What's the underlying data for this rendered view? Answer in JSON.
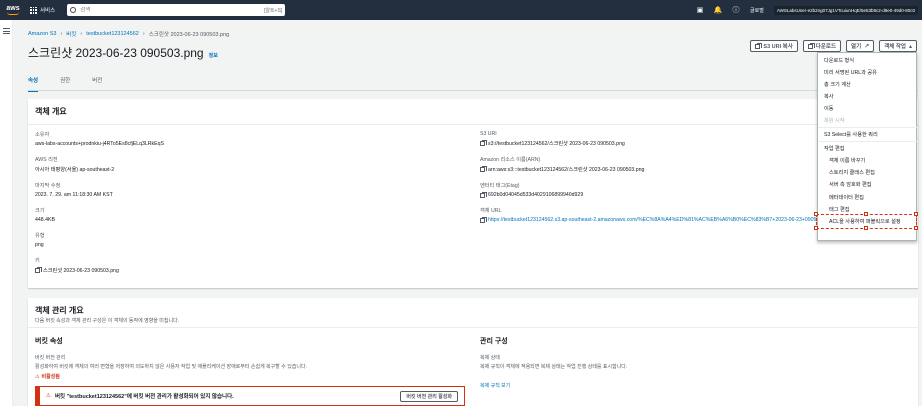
{
  "topnav": {
    "logo": "aws",
    "services": "서비스",
    "search_placeholder": "검색",
    "search_hint": "[알트+S]",
    "region": "글로벌",
    "account": "AWSLabsUser-e2b2ng07Jg1VTcuiunHqE/5e53b9c2-d9e0-49d0-80c0"
  },
  "breadcrumb": [
    "Amazon S3",
    "버킷",
    "testbucket123124562",
    "스크린샷 2023-06-23 090503.png"
  ],
  "title": "스크린샷 2023-06-23 090503.png",
  "info_link": "정보",
  "actions": {
    "copy_uri": "S3 URI 복사",
    "download": "다운로드",
    "open": "열기",
    "object_actions": "객체 작업"
  },
  "tabs": [
    "속성",
    "권한",
    "버전"
  ],
  "overview": {
    "heading": "객체 개요",
    "left": [
      {
        "label": "소유자",
        "value": "aws-labs-accounts+prodnkiu-j4RTo5Es8cfjELq3LRkEqS"
      },
      {
        "label": "AWS 리전",
        "value": "아시아 태평양(서울) ap-southeast-2"
      },
      {
        "label": "마지막 수정",
        "value": "2023. 7. 29. am 11:18:30 AM KST"
      },
      {
        "label": "크기",
        "value": "448.4KB"
      },
      {
        "label": "유형",
        "value": "png"
      },
      {
        "label": "키",
        "value": "스크린샷 2023-06-23 090503.png"
      }
    ],
    "right": [
      {
        "label": "S3 URI",
        "value": "s3://testbucket123124562/스크린샷 2023-06-23 090503.png"
      },
      {
        "label": "Amazon 리소스 이름(ARN)",
        "value": "arn:aws:s3:::testbucket123124562/스크린샷 2023-06-23 090503.png"
      },
      {
        "label": "엔터티 태그(Etag)",
        "value": "692b0d04045d533d4029106899940d929"
      },
      {
        "label": "객체 URL",
        "value": "https://testbucket123124562.s3.ap-southeast-2.amazonaws.com/%EC%8A%A4%ED%81%AC%EB%A6%B0%EC%83%B7+2023-06-23+090503.png"
      }
    ]
  },
  "management": {
    "heading": "객체 관리 개요",
    "desc": "다음 버킷 속성과 객체 관리 구성은 이 객체의 동작에 영향을 미칩니다.",
    "versioning_title": "버킷 속성",
    "versioning_label": "버킷 버전 관리",
    "versioning_desc": "활성화하여 버킷에 객체의 여러 변형을 저장하여 의도하지 않은 사용자 작업 및 애플리케이션 장애로부터 손쉽게 복구할 수 있습니다.",
    "versioning_value": "비활성됨",
    "mgmt_title": "관리 구성",
    "mgmt_label": "복제 상태",
    "mgmt_desc": "복제 규칙이 객체에 적용되면 복제 상태는 작업 진행 상태를 표시합니다.",
    "mgmt_link": "복제 규칙 보기",
    "alert_text": "버킷 \"testbucket123124562\"에 버킷 버전 관리가 활성화되어 있지 않습니다.",
    "alert_button": "버킷 버전 관리 활성화"
  },
  "dropdown": {
    "items": [
      {
        "label": "다운로드 형식",
        "state": "normal"
      },
      {
        "label": "미리 서명된 URL과 공유",
        "state": "normal"
      },
      {
        "label": "총 크기 계산",
        "state": "normal"
      },
      {
        "label": "복사",
        "state": "normal"
      },
      {
        "label": "이동",
        "state": "normal"
      },
      {
        "label": "복원 시작",
        "state": "disabled"
      },
      {
        "label": "S3 Select를 사용한 쿼리",
        "state": "normal"
      },
      {
        "label": "작업 편집",
        "state": "group"
      },
      {
        "label": "객체 이름 바꾸기",
        "state": "indent"
      },
      {
        "label": "스토리지 클래스 편집",
        "state": "indent"
      },
      {
        "label": "서버 측 암호화 편집",
        "state": "indent"
      },
      {
        "label": "메타데이터 편집",
        "state": "indent"
      },
      {
        "label": "태그 편집",
        "state": "indent"
      },
      {
        "label": "ACL을 사용하여 퍼블릭으로 설정",
        "state": "indent"
      }
    ]
  },
  "colors": {
    "nav": "#232f3e",
    "link": "#0073bb",
    "accent": "#ff9900",
    "danger": "#d13212"
  }
}
